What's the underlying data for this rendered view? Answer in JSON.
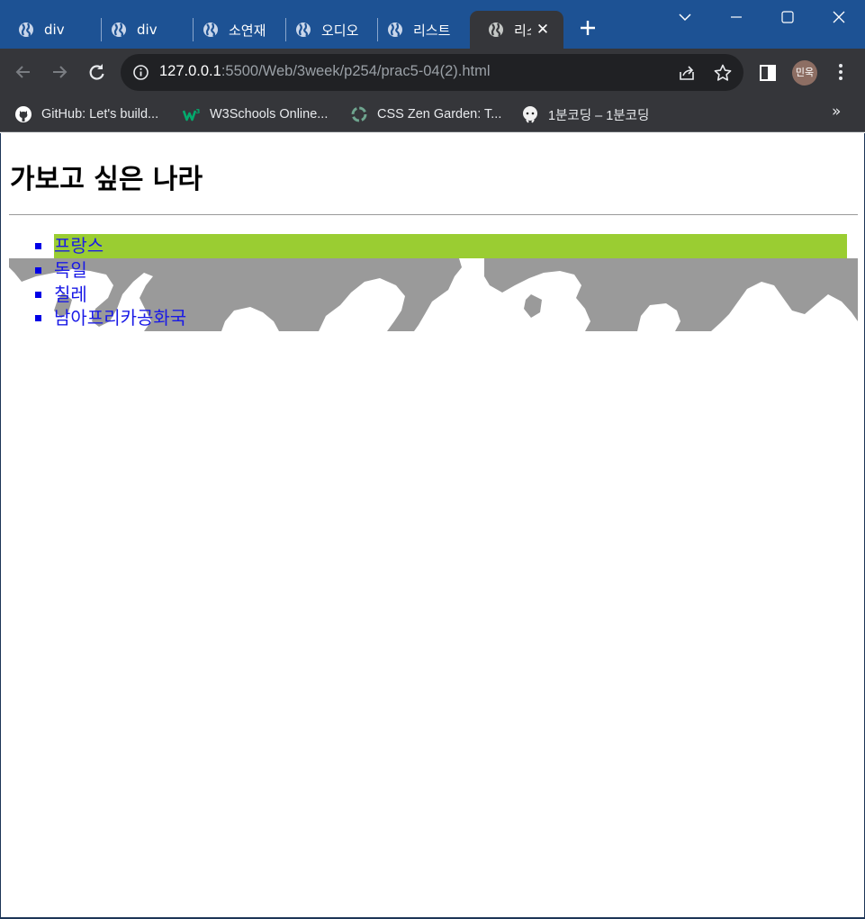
{
  "browser": {
    "tabs": [
      {
        "label": "div"
      },
      {
        "label": "div"
      },
      {
        "label": "소연재"
      },
      {
        "label": "오디오"
      },
      {
        "label": "리스트"
      },
      {
        "label": "리스트"
      }
    ],
    "address": {
      "host": "127.0.0.1",
      "path": ":5500/Web/3week/p254/prac5-04(2).html"
    },
    "profile": {
      "initials": "민욱"
    },
    "bookmarks": [
      {
        "label": "GitHub: Let's build...",
        "icon": "github-icon"
      },
      {
        "label": "W3Schools Online...",
        "icon": "w3schools-icon"
      },
      {
        "label": "CSS Zen Garden: T...",
        "icon": "zen-garden-icon"
      },
      {
        "label": "1분코딩 – 1분코딩",
        "icon": "1min-coding-icon"
      }
    ],
    "bookmarks_more": "»",
    "colors": {
      "tabstrip": "#1d5294",
      "toolbar": "#35363a",
      "omnibox": "#202124"
    }
  },
  "page": {
    "title": "가보고 싶은 나라",
    "countries": [
      {
        "name": "프랑스"
      },
      {
        "name": "독일"
      },
      {
        "name": "칠레"
      },
      {
        "name": "남아프리카공화국"
      }
    ],
    "colors": {
      "highlight": "#9acd32",
      "link": "#1a1ae6",
      "bullet": "#0000e6",
      "map": "#9a9a9a"
    }
  }
}
